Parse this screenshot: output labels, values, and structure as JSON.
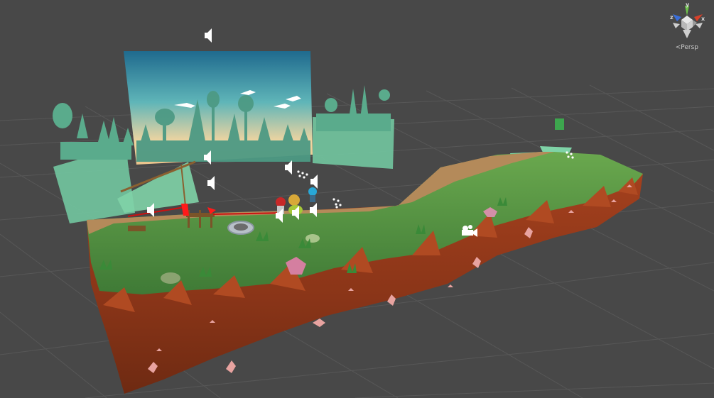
{
  "editor": {
    "projection_mode": "Persp",
    "gizmo_axes": {
      "y": "y",
      "x": "x",
      "z": "z"
    },
    "background_color": "#484848"
  },
  "scene": {
    "icons": [
      "audio-source-icon",
      "particle-system-icon",
      "camera-icon",
      "sprite-icon"
    ],
    "colors": {
      "grass": "#5e9a48",
      "dirt": "#b04a22",
      "path": "#b48a5a",
      "sky_top": "#2c7ea0",
      "sky_bottom": "#f3d6a6",
      "forest_layer": "#6cc49a"
    }
  }
}
